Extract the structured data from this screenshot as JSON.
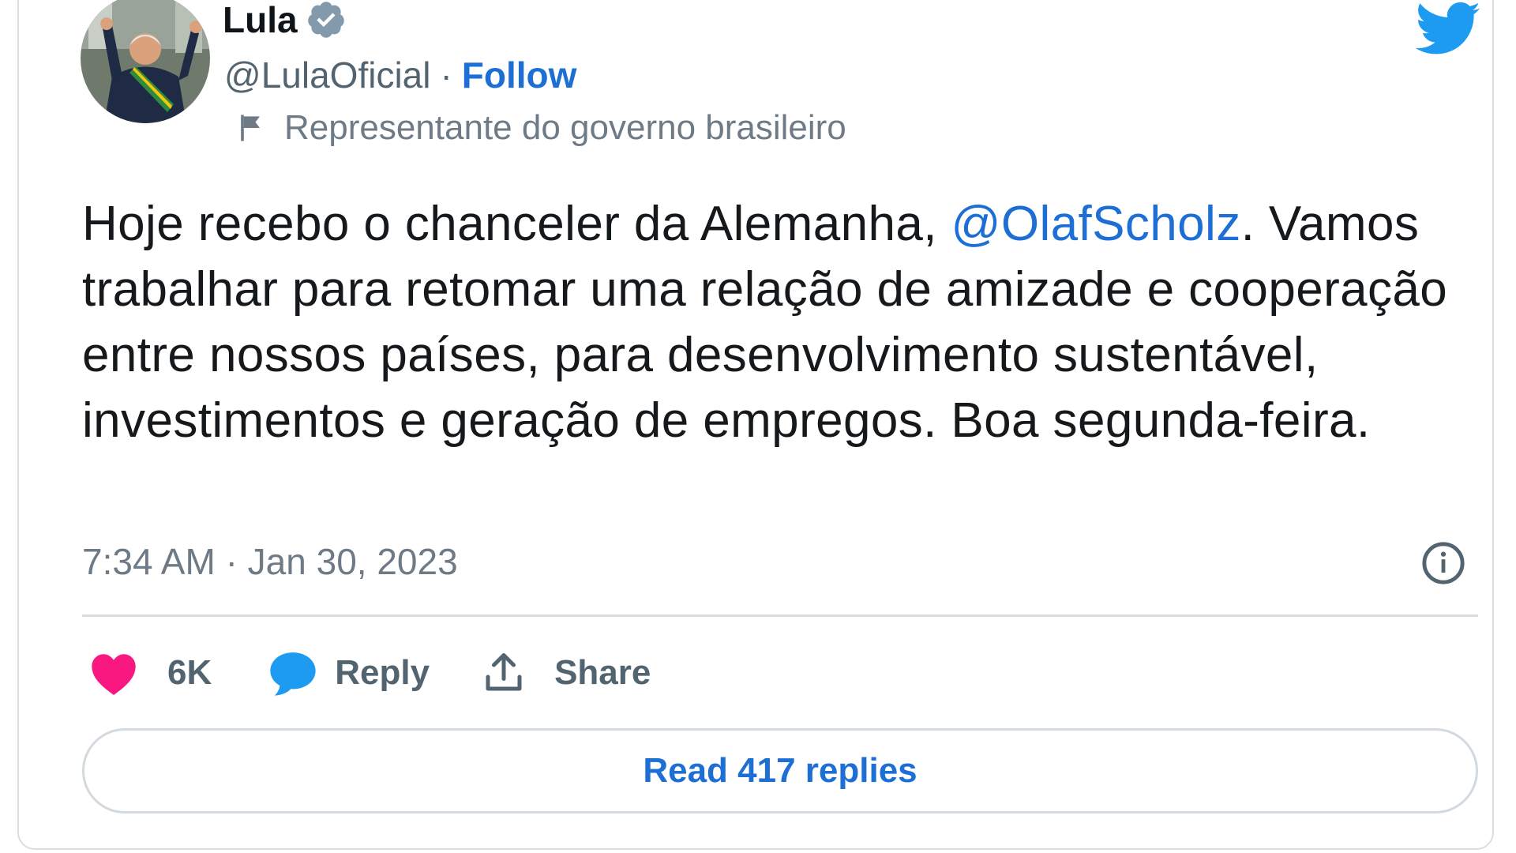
{
  "author": {
    "name": "Lula",
    "handle": "@LulaOficial",
    "separator": "·",
    "follow_label": "Follow",
    "affiliation_label": "Representante do governo brasileiro",
    "avatar_icon": "avatar-photo",
    "verified_icon": "verified-badge-icon"
  },
  "tweet": {
    "text_before_mention": "Hoje recebo o chanceler da Alemanha, ",
    "mention": "@OlafScholz",
    "text_after_mention": ". Vamos trabalhar para retomar uma relação de amizade e cooperação entre nossos países, para desenvolvimento sustentável, investimentos e geração de empregos. Boa segunda-feira.",
    "time": "7:34 AM",
    "meta_separator": "·",
    "date": "Jan 30, 2023"
  },
  "actions": {
    "like_count": "6K",
    "reply_label": "Reply",
    "share_label": "Share"
  },
  "read_replies_label": "Read 417 replies",
  "colors": {
    "brand_blue": "#1d9bf0",
    "link_blue": "#1d6fd6",
    "like_pink": "#f91880",
    "verified_gray": "#829aab",
    "secondary_text": "#536471"
  }
}
